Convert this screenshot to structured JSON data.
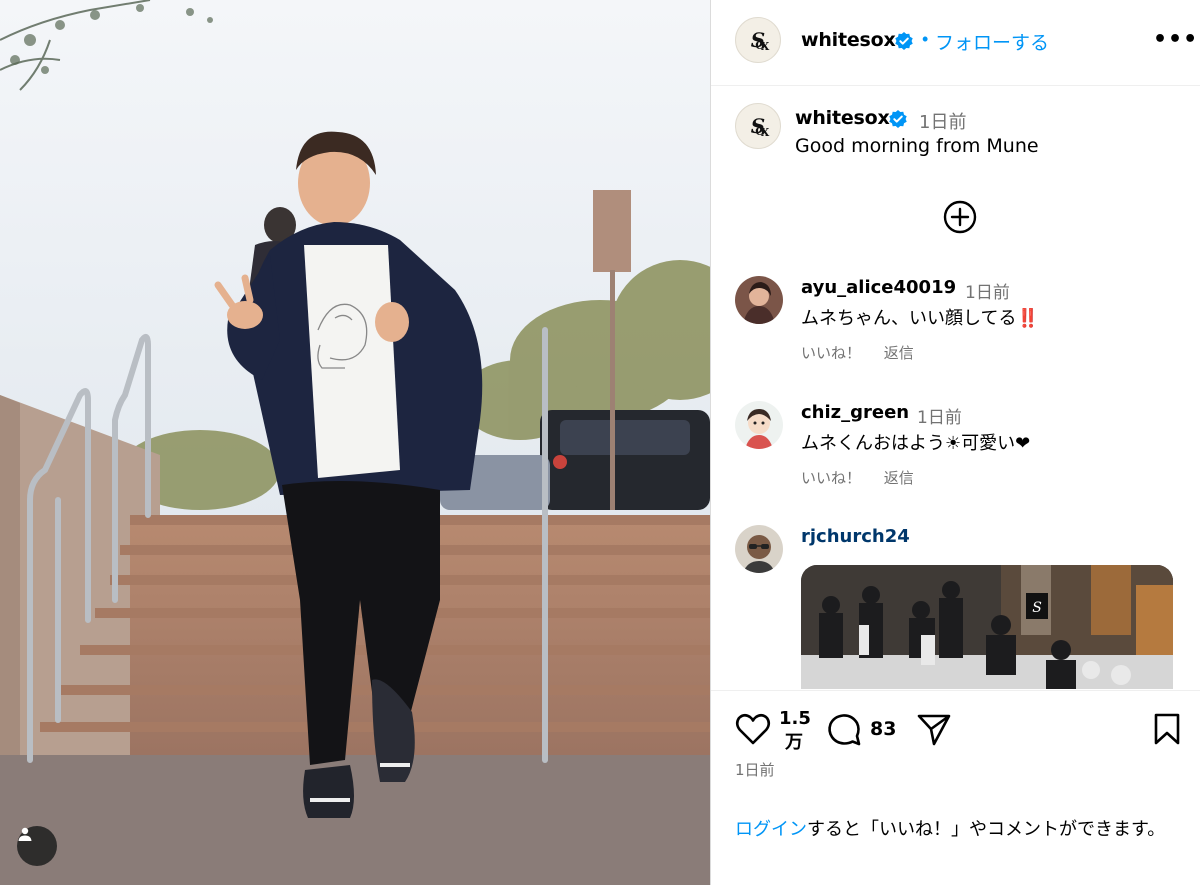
{
  "post": {
    "author": "whitesox",
    "follow_label": "フォローする",
    "dot": "•",
    "more_label": "•••",
    "caption": "Good morning from Mune",
    "time": "1日前"
  },
  "comments": [
    {
      "user": "ayu_alice40019",
      "time": "1日前",
      "text": "ムネちゃん、いい顔してる‼️",
      "like_label": "いいね！",
      "reply_label": "返信"
    },
    {
      "user": "chiz_green",
      "time": "1日前",
      "text": "ムネくんおはよう☀可愛い❤",
      "like_label": "いいね！",
      "reply_label": "返信"
    },
    {
      "user": "rjchurch24"
    }
  ],
  "stats": {
    "likes_line1": "1.5",
    "likes_line2": "万",
    "comments": "83",
    "date": "1日前"
  },
  "login": {
    "link_label": "ログイン",
    "rest": "すると「いいね！」やコメントができます。"
  },
  "icons": {
    "verified": "verified-badge-icon",
    "user_tag": "user-tag-icon",
    "load_more": "plus-circle-icon",
    "like": "heart-icon",
    "comment": "comment-bubble-icon",
    "share": "paper-plane-icon",
    "save": "bookmark-icon"
  },
  "colors": {
    "accent": "#0095f6",
    "secondary_text": "#737373",
    "verified": "#0095f6"
  }
}
